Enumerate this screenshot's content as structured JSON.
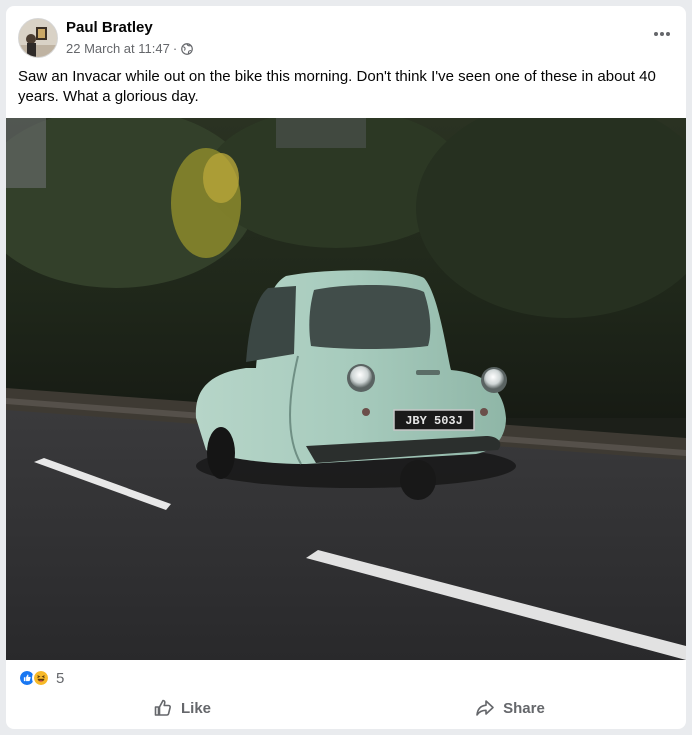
{
  "post": {
    "author": "Paul Bratley",
    "timestamp": "22 March at 11:47",
    "separator": "·",
    "privacy_icon": "globe-icon",
    "menu_icon": "more-options-icon",
    "text": "Saw an Invacar while out on the bike this morning. Don't think I've seen one of these in about 40 years. What a glorious day.",
    "photo": {
      "subject": "pale blue Invacar three-wheeler on road",
      "number_plate": "JBY 503J"
    }
  },
  "reactions": {
    "icons": [
      "like-reaction-icon",
      "haha-reaction-icon"
    ],
    "count": "5"
  },
  "actions": {
    "like_label": "Like",
    "share_label": "Share"
  },
  "colors": {
    "text": "#050505",
    "secondary_text": "#65676b",
    "like_blue": "#1877f2",
    "haha_yellow": "#f7b928",
    "background": "#e9ebee"
  }
}
